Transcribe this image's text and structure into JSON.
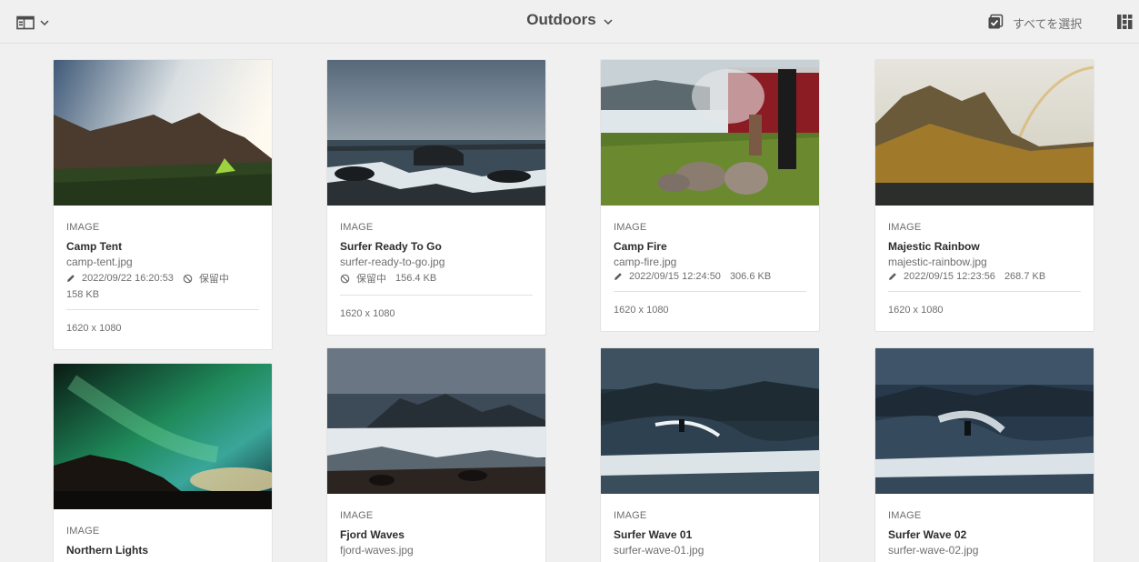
{
  "header": {
    "title": "Outdoors",
    "select_all_label": "すべてを選択"
  },
  "cards": [
    {
      "type": "IMAGE",
      "title": "Camp Tent",
      "filename": "camp-tent.jpg",
      "modified": "2022/09/22 16:20:53",
      "status": "保留中",
      "size": "158 KB",
      "dimensions": "1620 x 1080"
    },
    {
      "type": "IMAGE",
      "title": "Surfer Ready To Go",
      "filename": "surfer-ready-to-go.jpg",
      "status": "保留中",
      "size": "156.4 KB",
      "dimensions": "1620 x 1080"
    },
    {
      "type": "IMAGE",
      "title": "Camp Fire",
      "filename": "camp-fire.jpg",
      "modified": "2022/09/15 12:24:50",
      "size": "306.6 KB",
      "dimensions": "1620 x 1080"
    },
    {
      "type": "IMAGE",
      "title": "Majestic Rainbow",
      "filename": "majestic-rainbow.jpg",
      "modified": "2022/09/15 12:23:56",
      "size": "268.7 KB",
      "dimensions": "1620 x 1080"
    },
    {
      "type": "IMAGE",
      "title": "Northern Lights"
    },
    {
      "type": "IMAGE",
      "title": "Fjord Waves",
      "filename": "fjord-waves.jpg"
    },
    {
      "type": "IMAGE",
      "title": "Surfer Wave 01",
      "filename": "surfer-wave-01.jpg"
    },
    {
      "type": "IMAGE",
      "title": "Surfer Wave 02",
      "filename": "surfer-wave-02.jpg"
    }
  ],
  "icons": {
    "rail_toggle": "side-panel-icon",
    "title_dropdown": "chevron-down-icon",
    "select_all": "checkbox-icon",
    "view_switch": "card-view-icon",
    "modified": "pencil-icon",
    "status": "pending-icon"
  },
  "colors": {
    "background": "#f0f0f0",
    "card": "#ffffff",
    "text_primary": "#2c2c2c",
    "text_secondary": "#6e6e6e"
  }
}
